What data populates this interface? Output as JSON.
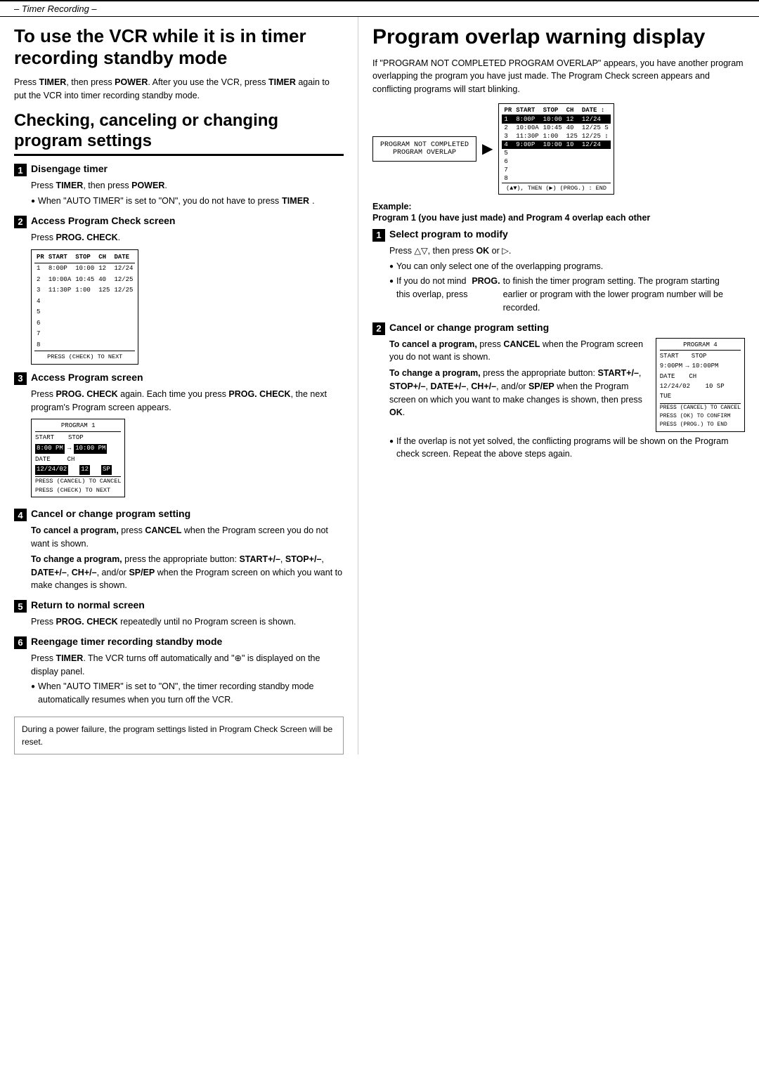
{
  "topbar": {
    "label": "– Timer Recording –"
  },
  "left": {
    "main_title": "To use the VCR while it is in timer recording standby mode",
    "main_intro": "Press TIMER, then press POWER. After you use the VCR, press TIMER again to put the VCR into timer recording standby mode.",
    "section_title": "Checking, canceling or changing program settings",
    "steps": [
      {
        "num": "1",
        "title": "Disengage timer",
        "body": [
          "Press TIMER, then press POWER.",
          "● When \"AUTO TIMER\" is set to \"ON\", you do not have to press TIMER."
        ]
      },
      {
        "num": "2",
        "title": "Access Program Check screen",
        "body": [
          "Press PROG. CHECK."
        ]
      },
      {
        "num": "3",
        "title": "Access Program screen",
        "body": [
          "Press PROG. CHECK again. Each time you press PROG. CHECK, the next program's Program screen appears."
        ]
      },
      {
        "num": "4",
        "title": "Cancel or change program setting",
        "body": [
          "To cancel a program, press CANCEL when the Program screen you do not want is shown.",
          "To change a program, press the appropriate button: START+/–, STOP+/–, DATE+/–, CH+/–, and/or SP/EP when the Program screen on which you want to make changes is shown."
        ]
      },
      {
        "num": "5",
        "title": "Return to normal screen",
        "body": [
          "Press PROG. CHECK repeatedly until no Program screen is shown."
        ]
      },
      {
        "num": "6",
        "title": "Reengage timer recording standby mode",
        "body": [
          "Press TIMER. The VCR turns off automatically and \"⊕\" is displayed on the display panel.",
          "● When \"AUTO TIMER\" is set to \"ON\", the timer recording standby mode automatically resumes when you turn off the VCR."
        ]
      }
    ],
    "notice": "During a power failure, the program settings listed in Program Check Screen will be reset.",
    "check_screen": {
      "rows": [
        {
          "pr": "1",
          "start": "8:00P",
          "stop": "10:00",
          "ch": "12",
          "date": "12/24"
        },
        {
          "pr": "2",
          "start": "10:00A",
          "stop": "10:45",
          "ch": "40",
          "date": "12/25"
        },
        {
          "pr": "3",
          "start": "11:30P",
          "stop": "1:00",
          "ch": "125",
          "date": "12/25"
        },
        {
          "pr": "4",
          "start": "",
          "stop": "",
          "ch": "",
          "date": ""
        },
        {
          "pr": "5",
          "start": "",
          "stop": "",
          "ch": "",
          "date": ""
        },
        {
          "pr": "6",
          "start": "",
          "stop": "",
          "ch": "",
          "date": ""
        },
        {
          "pr": "7",
          "start": "",
          "stop": "",
          "ch": "",
          "date": ""
        },
        {
          "pr": "8",
          "start": "",
          "stop": "",
          "ch": "",
          "date": ""
        }
      ],
      "footer": "PRESS (CHECK) TO NEXT"
    },
    "program1_screen": {
      "title": "PROGRAM 1",
      "start_label": "START",
      "stop_label": "STOP",
      "start_val": "8:00 PM",
      "arrow": "→",
      "stop_val": "10:00 PM",
      "date_label": "DATE",
      "ch_label": "CH",
      "date_val": "12/24/02",
      "ch_val": "12",
      "sp_val": "SP",
      "footer1": "PRESS (CANCEL) TO CANCEL",
      "footer2": "PRESS (CHECK) TO NEXT"
    }
  },
  "right": {
    "title": "Program overlap warning display",
    "intro1": "If \"PROGRAM NOT COMPLETED PROGRAM OVERLAP\"",
    "intro2": "appears, you have another program overlapping the program you have just made. The Program Check screen appears and conflicting programs will start blinking.",
    "overlap_msg1": "PROGRAM NOT COMPLETED",
    "overlap_msg2": "PROGRAM OVERLAP",
    "example_label": "Example:",
    "example_desc": "Program 1 (you have just made) and Program 4 overlap each other",
    "check_screen2": {
      "headers": [
        "PR",
        "START",
        "STOP",
        "CH",
        "DATE"
      ],
      "rows": [
        {
          "pr": "1",
          "start": "8:00P",
          "stop": "10:00",
          "ch": "12",
          "date": "12/24",
          "highlight": true
        },
        {
          "pr": "2",
          "start": "10:00A",
          "stop": "10:45",
          "ch": "40",
          "date": "12/25",
          "highlight": false
        },
        {
          "pr": "3",
          "start": "11:30P",
          "stop": "1:00",
          "ch": "125",
          "date": "12/25",
          "highlight": false
        },
        {
          "pr": "4",
          "start": "9:00P",
          "stop": "10:00",
          "ch": "10",
          "date": "12/24",
          "highlight": true
        },
        {
          "pr": "5",
          "start": "",
          "stop": "",
          "ch": "",
          "date": "",
          "highlight": false
        },
        {
          "pr": "6",
          "start": "",
          "stop": "",
          "ch": "",
          "date": "",
          "highlight": false
        },
        {
          "pr": "7",
          "start": "",
          "stop": "",
          "ch": "",
          "date": "",
          "highlight": false
        },
        {
          "pr": "8",
          "start": "",
          "stop": "",
          "ch": "",
          "date": "",
          "highlight": false
        }
      ],
      "footer": "(▲▼), THEN (▶) (PROG.) : END"
    },
    "steps": [
      {
        "num": "1",
        "title": "Select program to modify",
        "body": [
          "Press △▽, then press OK or ▷.",
          "● You can only select one of the overlapping programs.",
          "● If you do not mind this overlap, press PROG. to finish the timer program setting. The program starting earlier or program with the lower program number will be recorded."
        ]
      },
      {
        "num": "2",
        "title": "Cancel or change program setting",
        "body": [
          "To cancel a program, press CANCEL when the Program screen you do not want is shown.",
          "To change a program, press the appropriate button: START+/–, STOP+/–, DATE+/–, CH+/–, and/or SP/EP when the Program screen on which you want to make changes is shown, then press OK.",
          "● If the overlap is not yet solved, the conflicting programs will be shown on the Program check screen. Repeat the above steps again."
        ]
      }
    ],
    "program4_screen": {
      "title": "PROGRAM 4",
      "start_label": "START",
      "stop_label": "STOP",
      "start_val": "9:00PM",
      "arrow": "→",
      "stop_val": "10:00PM",
      "date_label": "DATE",
      "ch_label": "CH",
      "date_val": "12/24/02",
      "ch_val": "10",
      "sp_val": "SP",
      "tue_label": "TUE",
      "footer1": "PRESS (CANCEL) TO CANCEL",
      "footer2": "PRESS (OK) TO CONFIRM",
      "footer3": "PRESS (PROG.) TO END"
    }
  }
}
